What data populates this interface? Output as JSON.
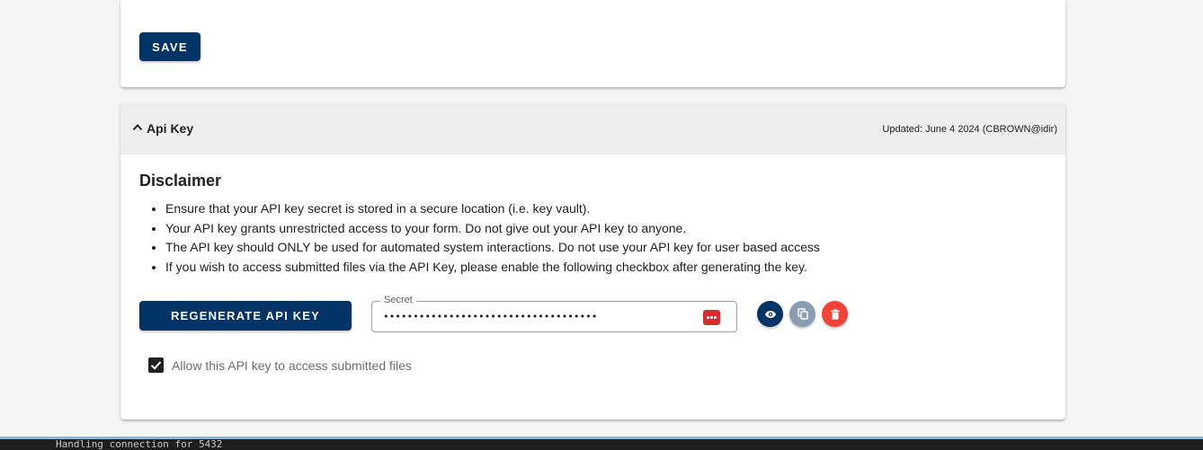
{
  "form_settings": {
    "save_label": "SAVE"
  },
  "api_key_panel": {
    "title": "Api Key",
    "updated": "Updated: June 4 2024 (CBROWN@idir)",
    "disclaimer_title": "Disclaimer",
    "disclaimer_items": [
      "Ensure that your API key secret is stored in a secure location (i.e. key vault).",
      "Your API key grants unrestricted access to your form. Do not give out your API key to anyone.",
      "The API key should ONLY be used for automated system interactions. Do not use your API key for user based access",
      "If you wish to access submitted files via the API Key, please enable the following checkbox after generating the key."
    ],
    "regenerate_label": "REGENERATE API KEY",
    "secret_label": "Secret",
    "secret_value": "••••••••••••••••••••••••••••••••••••",
    "show_icon": "eye-icon",
    "copy_icon": "copy-icon",
    "delete_icon": "trash-icon",
    "allow_files_checked": true,
    "allow_files_label": "Allow this API key to access submitted files"
  },
  "terminal": {
    "line": "Handling connection for 5432"
  },
  "colors": {
    "primary": "#003366",
    "danger": "#f44336",
    "disabled": "#8b9db3",
    "header_bg": "#eeeeee"
  }
}
